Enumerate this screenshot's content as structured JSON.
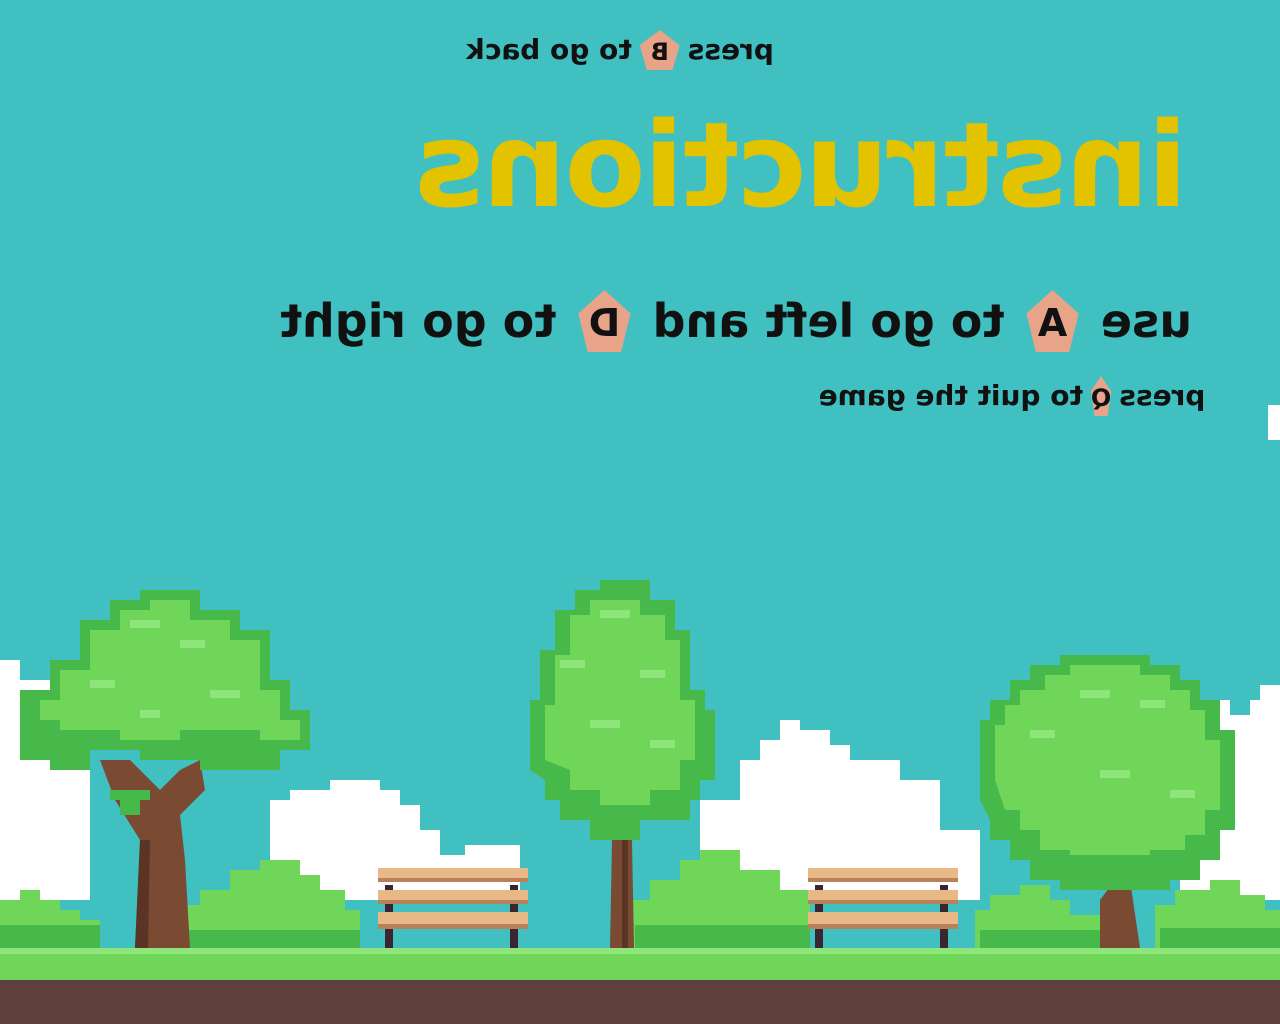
{
  "hint_back": {
    "before": "press",
    "key": "B",
    "after": "to go back"
  },
  "title": "instructions",
  "move": {
    "w1": "use",
    "key1": "A",
    "w2": "to go left and",
    "key2": "D",
    "w3": "to go right"
  },
  "quit": {
    "before": "press",
    "key": "Q",
    "after": "to quit the game"
  },
  "colors": {
    "sky": "#40c0c0",
    "title": "#e3c300",
    "key": "#e8a489",
    "grass": "#6fd65a",
    "dirt": "#5e3f3c"
  }
}
